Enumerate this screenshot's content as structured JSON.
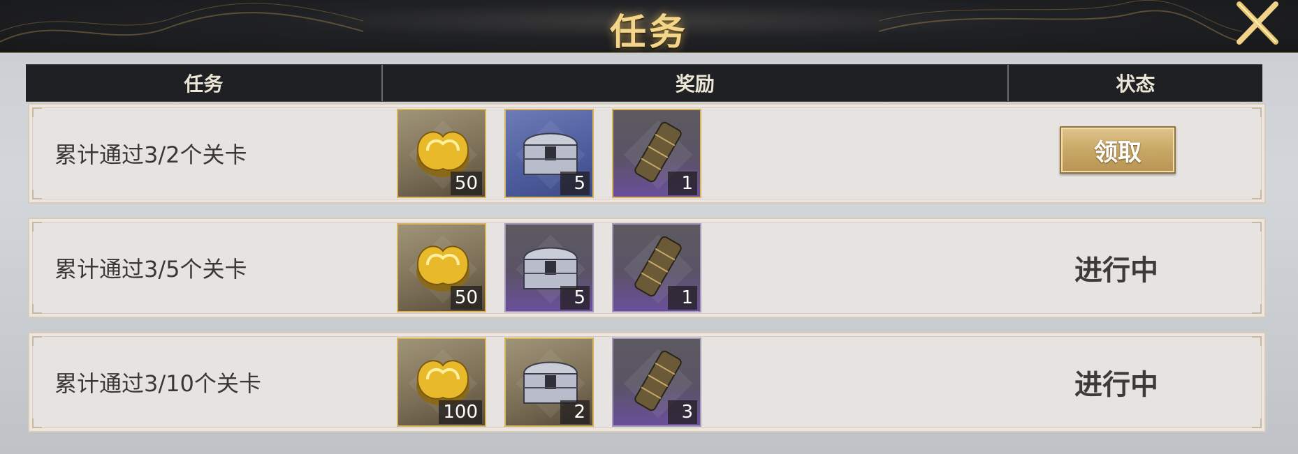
{
  "title": "任务",
  "header": {
    "task": "任务",
    "reward": "奖励",
    "status": "状态"
  },
  "rows": [
    {
      "task": "累计通过3/2个关卡",
      "rewards": [
        {
          "icon": "gold-coin-icon",
          "qty": "50",
          "rarity": "gold"
        },
        {
          "icon": "treasure-chest-icon",
          "qty": "5",
          "rarity": "blue"
        },
        {
          "icon": "scroll-icon",
          "qty": "1",
          "rarity": "purple"
        }
      ],
      "status": "领取"
    },
    {
      "task": "累计通过3/5个关卡",
      "rewards": [
        {
          "icon": "gold-coin-icon",
          "qty": "50",
          "rarity": "gold"
        },
        {
          "icon": "treasure-chest-icon",
          "qty": "5",
          "rarity": "purple"
        },
        {
          "icon": "scroll-icon",
          "qty": "1",
          "rarity": "purple"
        }
      ],
      "status": "进行中"
    },
    {
      "task": "累计通过3/10个关卡",
      "rewards": [
        {
          "icon": "gold-coin-icon",
          "qty": "100",
          "rarity": "gold"
        },
        {
          "icon": "treasure-chest-icon",
          "qty": "2",
          "rarity": "gold"
        },
        {
          "icon": "scroll-icon",
          "qty": "3",
          "rarity": "purple"
        }
      ],
      "status": "进行中"
    }
  ],
  "colors": {
    "accent_gold": "#d8b45c",
    "title_gold": "#f3d68a",
    "header_bg": "#1e2023"
  }
}
